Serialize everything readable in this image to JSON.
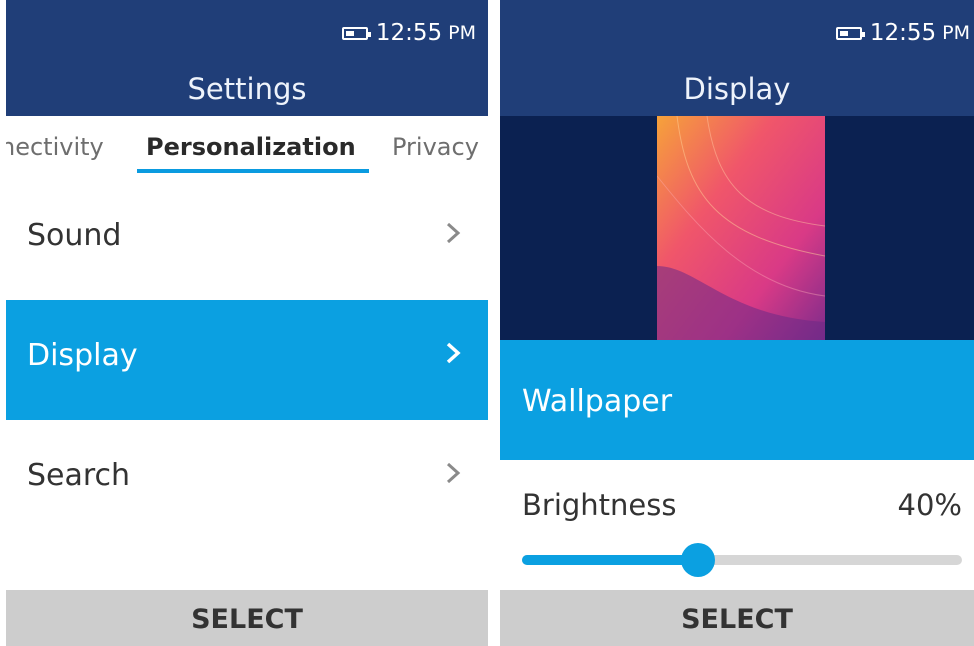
{
  "colors": {
    "header": "#203e78",
    "accent": "#0ba0e1",
    "wallpaper_bg": "#0b2151",
    "softkey": "#cdcdcd"
  },
  "left_screen": {
    "status": {
      "time": "12:55",
      "ampm": "PM",
      "battery_icon": "battery-icon"
    },
    "title": "Settings",
    "tabs": [
      "nectivity",
      "Personalization",
      "Privacy"
    ],
    "active_tab": "Personalization",
    "menu": [
      {
        "label": "Sound",
        "selected": false
      },
      {
        "label": "Display",
        "selected": true
      },
      {
        "label": "Search",
        "selected": false
      }
    ],
    "softkey": "SELECT"
  },
  "right_screen": {
    "status": {
      "time": "12:55",
      "ampm": "PM",
      "battery_icon": "battery-icon"
    },
    "title": "Display",
    "wallpaper": {
      "label": "Wallpaper"
    },
    "brightness": {
      "label": "Brightness",
      "value_text": "40%",
      "level": 0.4
    },
    "softkey": "SELECT"
  }
}
